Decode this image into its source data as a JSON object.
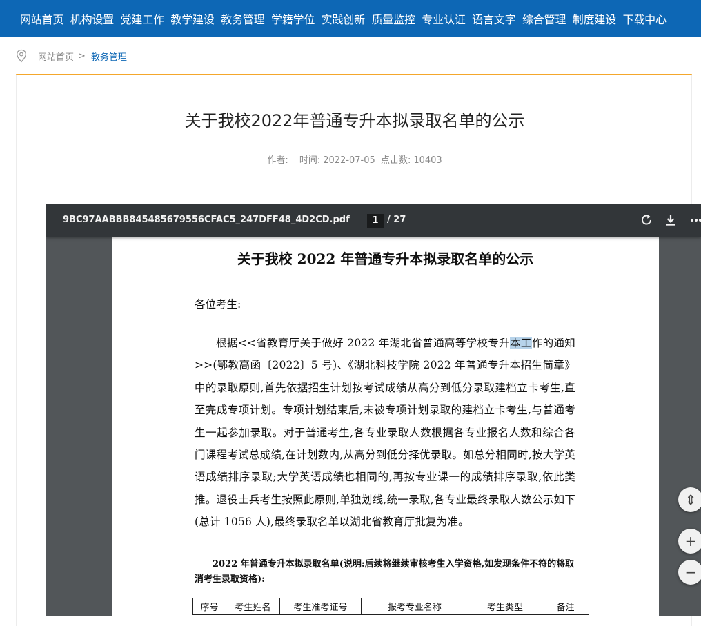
{
  "nav": {
    "items": [
      "网站首页",
      "机构设置",
      "党建工作",
      "教学建设",
      "教务管理",
      "学籍学位",
      "实践创新",
      "质量监控",
      "专业认证",
      "语言文字",
      "综合管理",
      "制度建设",
      "下载中心"
    ]
  },
  "breadcrumb": {
    "home": "网站首页",
    "separator": ">",
    "current": "教务管理"
  },
  "article": {
    "title": "关于我校2022年普通专升本拟录取名单的公示",
    "author_label": "作者:",
    "time_label": "时间:",
    "date": "2022-07-05",
    "clicks_label": "点击数:",
    "clicks": "10403"
  },
  "pdf": {
    "filename": "9BC97AABBB845485679556CFAC5_247DFF48_4D2CD.pdf",
    "current_page": "1",
    "total_pages": "/ 27",
    "icons": [
      "rotate-icon",
      "download-icon",
      "more-icon"
    ],
    "doc_title": "关于我校 2022 年普通专升本拟录取名单的公示",
    "greeting": "各位考生:",
    "para_before": "根据<<省教育厅关于做好 2022 年湖北省普通高等学校专升",
    "para_highlight": "本工",
    "para_after": "作的通知>>(鄂教高函〔2022〕5 号)、《湖北科技学院 2022 年普通专升本招生简章》中的录取原则,首先依据招生计划按考试成绩从高分到低分录取建档立卡考生,直至完成专项计划。专项计划结束后,未被专项计划录取的建档立卡考生,与普通考生一起参加录取。对于普通考生,各专业录取人数根据各专业报名人数和综合各门课程考试总成绩,在计划数内,从高分到低分择优录取。如总分相同时,按大学英语成绩排序录取;大学英语成绩也相同的,再按专业课一的成绩排序录取,依此类推。退役士兵考生按照此原则,单独划线,统一录取,各专业最终录取人数公示如下(总计 1056 人),最终录取名单以湖北省教育厅批复为准。",
    "table_caption": "2022 年普通专升本拟录取名单(说明:后续将继续审核考生入学资格,如发现条件不符的将取消考生录取资格):",
    "table_headers": [
      "序号",
      "考生姓名",
      "考生准考证号",
      "报考专业名称",
      "考生类型",
      "备注"
    ]
  },
  "controls": {
    "fit": "⇕",
    "zoom_in": "+",
    "zoom_out": "−"
  },
  "colors": {
    "nav_bg": "#0d67b5",
    "accent": "#f4a72c",
    "viewer_bg": "#525659",
    "toolbar_bg": "#323639"
  }
}
